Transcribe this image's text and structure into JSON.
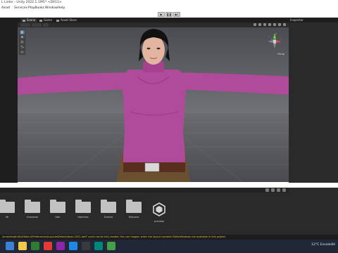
{
  "window": {
    "title": "L Linter - Unity 2022.1.19f1* <DX11>"
  },
  "menu": [
    "Asset",
    "Services",
    "PlayBooks",
    "Window",
    "Help"
  ],
  "play_controls": {
    "play": "▶",
    "pause": "❚❚",
    "step": "▶|"
  },
  "tabs": [
    "Scene",
    "Game",
    "Asset Store"
  ],
  "inspector": {
    "tab": "Inspector"
  },
  "viewport": {
    "persp_label": "Persp",
    "gizmo": {
      "y": "y",
      "x": "x",
      "z": "z"
    }
  },
  "project": {
    "assets": [
      {
        "label": "Mi",
        "type": "folder"
      },
      {
        "label": "character",
        "type": "folder"
      },
      {
        "label": "Hair",
        "type": "folder"
      },
      {
        "label": "Hairlines",
        "type": "folder"
      },
      {
        "label": "Scenes",
        "type": "folder"
      },
      {
        "label": "Textures",
        "type": "folder"
      },
      {
        "label": "preview",
        "type": "unity"
      }
    ]
  },
  "status": {
    "message": "\\nmeshingEntityEditor-S/Preferences/LayoutsDefault/dash-2022.dwlf' could not be fully loaded, this can happen when the layout contains EditorWindows not available in this project."
  },
  "tray": {
    "text": "12°C  Ensoleillé"
  },
  "colors": {
    "accent": "#3d7ac2",
    "sweater": "#b04a9a",
    "status_text": "#f0c24a"
  }
}
